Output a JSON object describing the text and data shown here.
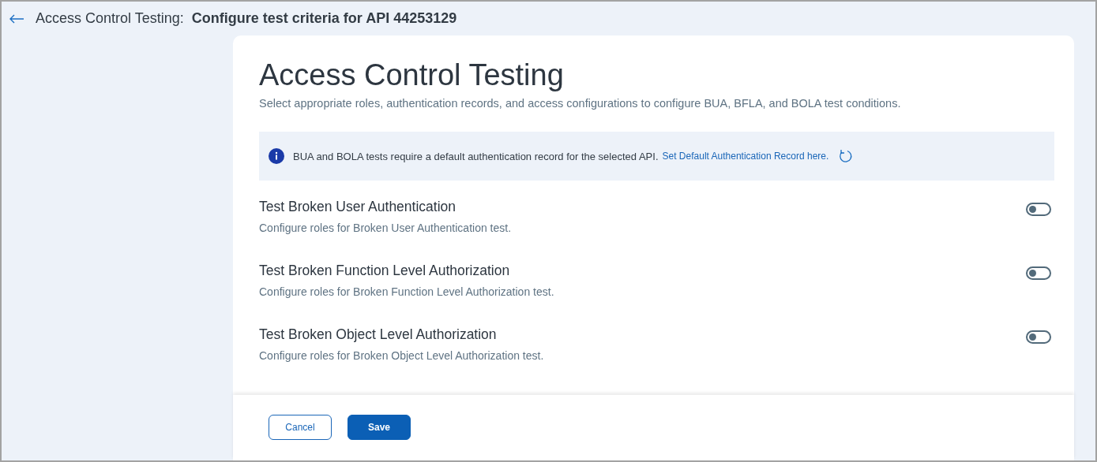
{
  "header": {
    "section": "Access Control Testing:",
    "title": "Configure test criteria for API 44253129"
  },
  "card": {
    "title": "Access Control Testing",
    "subtitle": "Select appropriate roles, authentication records, and access configurations to configure BUA, BFLA, and BOLA test conditions."
  },
  "notice": {
    "message": "BUA and BOLA tests require a default authentication record for the selected API.",
    "link": "Set Default Authentication Record here."
  },
  "tests": [
    {
      "title": "Test Broken User Authentication",
      "description": "Configure roles for Broken User Authentication test.",
      "on": false
    },
    {
      "title": "Test Broken Function Level Authorization",
      "description": "Configure roles for Broken Function Level Authorization test.",
      "on": false
    },
    {
      "title": "Test Broken Object Level Authorization",
      "description": "Configure roles for Broken Object Level Authorization test.",
      "on": false
    }
  ],
  "buttons": [
    {
      "label": "Cancel",
      "kind": "secondary"
    },
    {
      "label": "Save",
      "kind": "primary"
    }
  ]
}
